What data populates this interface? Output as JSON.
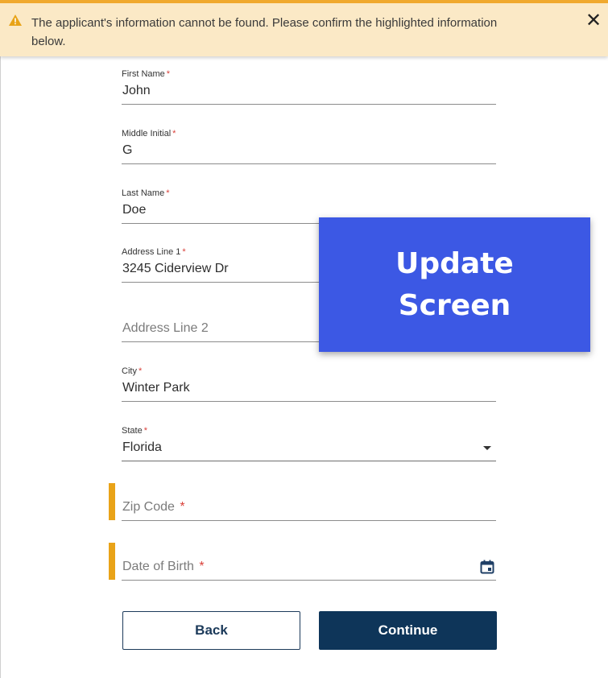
{
  "alert": {
    "message": "The applicant's information cannot be found. Please confirm the highlighted information below.",
    "icon": "warning-icon",
    "close_icon": "close-icon",
    "close_glyph": "✕"
  },
  "form": {
    "first_name": {
      "label": "First Name",
      "required": "*",
      "value": "John"
    },
    "middle_initial": {
      "label": "Middle Initial",
      "required": "*",
      "value": "G"
    },
    "last_name": {
      "label": "Last Name",
      "required": "*",
      "value": "Doe"
    },
    "address1": {
      "label": "Address Line 1",
      "required": "*",
      "value": "3245 Ciderview Dr"
    },
    "address2": {
      "placeholder": "Address Line 2"
    },
    "city": {
      "label": "City",
      "required": "*",
      "value": "Winter Park"
    },
    "state": {
      "label": "State",
      "required": "*",
      "value": "Florida"
    },
    "zip": {
      "placeholder": "Zip Code",
      "required": "*"
    },
    "dob": {
      "placeholder": "Date of Birth",
      "required": "*"
    }
  },
  "overlay": {
    "text": "Update Screen"
  },
  "buttons": {
    "back": "Back",
    "continue": "Continue"
  },
  "colors": {
    "accent": "#e9a318",
    "primary": "#0e3559",
    "overlay": "#3c58e4",
    "required": "#d9413a"
  }
}
